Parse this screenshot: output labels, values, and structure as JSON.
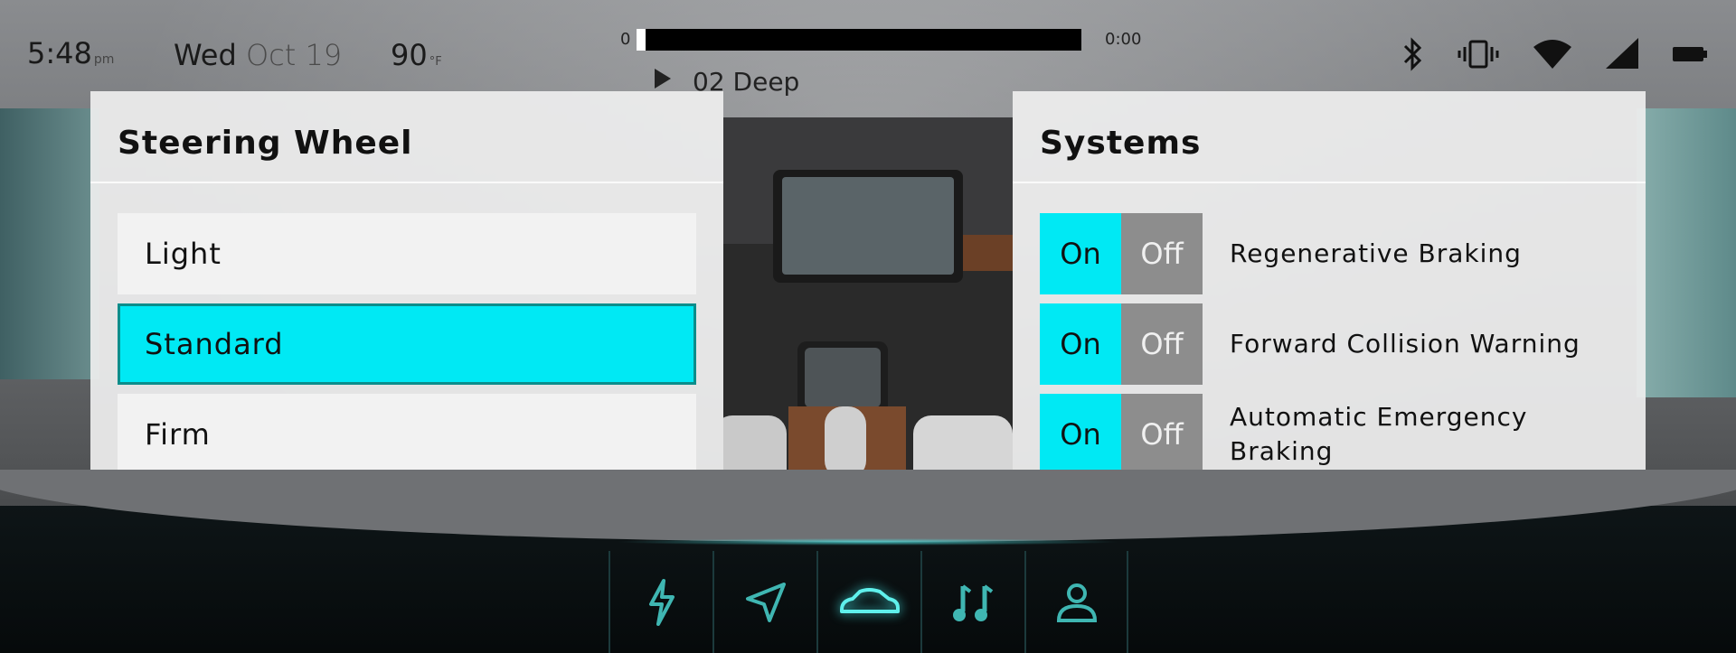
{
  "status_bar": {
    "time": "5:48",
    "ampm": "pm",
    "day": "Wed",
    "date": "Oct 19",
    "temperature": "90",
    "temperature_unit": "°F",
    "icons": [
      "bluetooth-icon",
      "vibrate-icon",
      "wifi-icon",
      "cellular-signal-icon",
      "battery-icon"
    ]
  },
  "media": {
    "position": "0",
    "duration": "0:00",
    "track": "02 Deep",
    "progress": 0
  },
  "steering_panel": {
    "title": "Steering Wheel",
    "options": [
      "Light",
      "Standard",
      "Firm"
    ],
    "selected": "Standard"
  },
  "systems_panel": {
    "title": "Systems",
    "toggles": [
      {
        "on_label": "On",
        "off_label": "Off",
        "label": "Regenerative Braking",
        "state": "On"
      },
      {
        "on_label": "On",
        "off_label": "Off",
        "label": "Forward Collision Warning",
        "state": "On"
      },
      {
        "on_label": "On",
        "off_label": "Off",
        "label": "Automatic Emergency Braking",
        "state": "On"
      }
    ]
  },
  "nav": {
    "items": [
      "charging-icon",
      "navigation-icon",
      "car-icon",
      "music-icon",
      "profile-icon"
    ],
    "active": "car-icon"
  },
  "colors": {
    "accent": "#00e9f4",
    "selected_border": "#0b8d8b",
    "toggle_off": "#8d8d8d",
    "nav_glow": "#40e0e0"
  }
}
